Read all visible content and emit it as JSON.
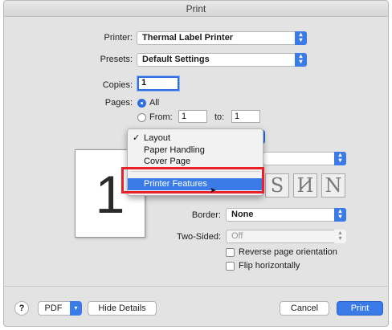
{
  "window": {
    "title": "Print"
  },
  "printer": {
    "label": "Printer:",
    "value": "Thermal Label Printer"
  },
  "presets": {
    "label": "Presets:",
    "value": "Default Settings"
  },
  "copies": {
    "label": "Copies:",
    "value": "1"
  },
  "pages": {
    "label": "Pages:",
    "all_label": "All",
    "from_label": "From:",
    "from_value": "1",
    "to_label": "to:",
    "to_value": "1"
  },
  "preview": {
    "page_number": "1"
  },
  "section_menu": {
    "items": [
      {
        "label": "Layout",
        "checked": true
      },
      {
        "label": "Paper Handling",
        "checked": false
      },
      {
        "label": "Cover Page",
        "checked": false
      },
      {
        "label": "Printer Features",
        "checked": false,
        "highlighted": true
      }
    ]
  },
  "layout": {
    "orientation_icons": [
      "S",
      "И",
      "N"
    ],
    "border_label": "Border:",
    "border_value": "None",
    "two_sided_label": "Two-Sided:",
    "two_sided_value": "Off",
    "reverse_label": "Reverse page orientation",
    "flip_label": "Flip horizontally"
  },
  "footer": {
    "help_label": "?",
    "pdf_label": "PDF",
    "hide_details_label": "Hide Details",
    "cancel_label": "Cancel",
    "print_label": "Print"
  },
  "colors": {
    "accent": "#3a7be8",
    "annotation": "#e8212b"
  }
}
